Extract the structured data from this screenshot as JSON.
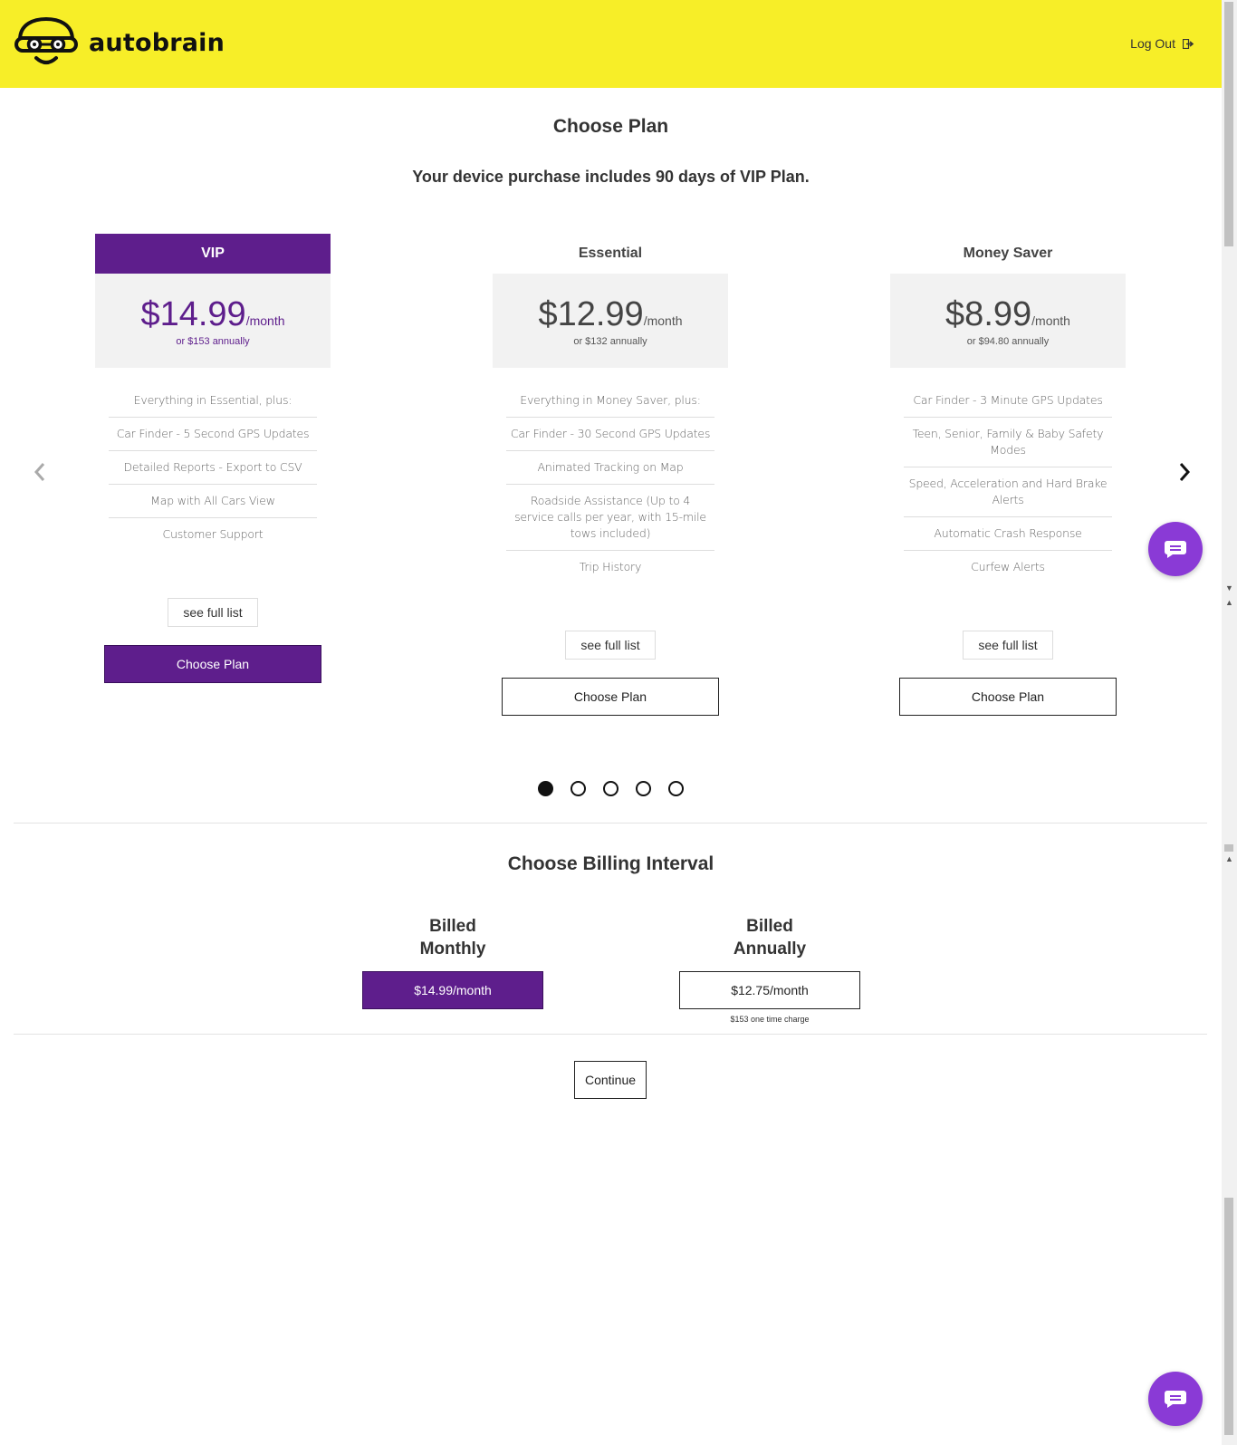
{
  "header": {
    "brand": "autobrain",
    "logout_label": "Log Out",
    "logout_icon": "sign-out-icon"
  },
  "colors": {
    "header_bg": "#f7ee28",
    "accent": "#5e1e8c",
    "chat": "#8a3ad6"
  },
  "page": {
    "title": "Choose Plan",
    "subtitle": "Your device purchase includes 90 days of VIP Plan."
  },
  "carousel": {
    "prev_icon": "chevron-left-icon",
    "next_icon": "chevron-right-icon",
    "dots": 5,
    "active_dot": 0
  },
  "plans": [
    {
      "name": "VIP",
      "price": "$14.99",
      "unit": "/month",
      "annual": "or $153 annually",
      "selected": true,
      "features": [
        "Everything in Essential, plus:",
        "Car Finder - 5 Second GPS Updates",
        "Detailed Reports - Export to CSV",
        "Map with All Cars View",
        "Customer Support"
      ],
      "see_full": "see full list",
      "choose": "Choose Plan"
    },
    {
      "name": "Essential",
      "price": "$12.99",
      "unit": "/month",
      "annual": "or $132 annually",
      "selected": false,
      "features": [
        "Everything in Money Saver, plus:",
        "Car Finder - 30 Second GPS Updates",
        "Animated Tracking on Map",
        "Roadside Assistance (Up to 4 service calls per year, with 15-mile tows included)",
        "Trip History"
      ],
      "see_full": "see full list",
      "choose": "Choose Plan"
    },
    {
      "name": "Money Saver",
      "price": "$8.99",
      "unit": "/month",
      "annual": "or $94.80 annually",
      "selected": false,
      "features": [
        "Car Finder - 3 Minute GPS Updates",
        "Teen, Senior, Family & Baby Safety Modes",
        "Speed, Acceleration and Hard Brake Alerts",
        "Automatic Crash Response",
        "Curfew Alerts"
      ],
      "see_full": "see full list",
      "choose": "Choose Plan"
    }
  ],
  "billing": {
    "title": "Choose Billing Interval",
    "monthly": {
      "label_line1": "Billed",
      "label_line2": "Monthly",
      "button": "$14.99/month",
      "selected": true
    },
    "annually": {
      "label_line1": "Billed",
      "label_line2": "Annually",
      "button": "$12.75/month",
      "note": "$153 one time charge",
      "selected": false
    }
  },
  "continue_label": "Continue",
  "chat_icon": "chat-bubble-icon"
}
